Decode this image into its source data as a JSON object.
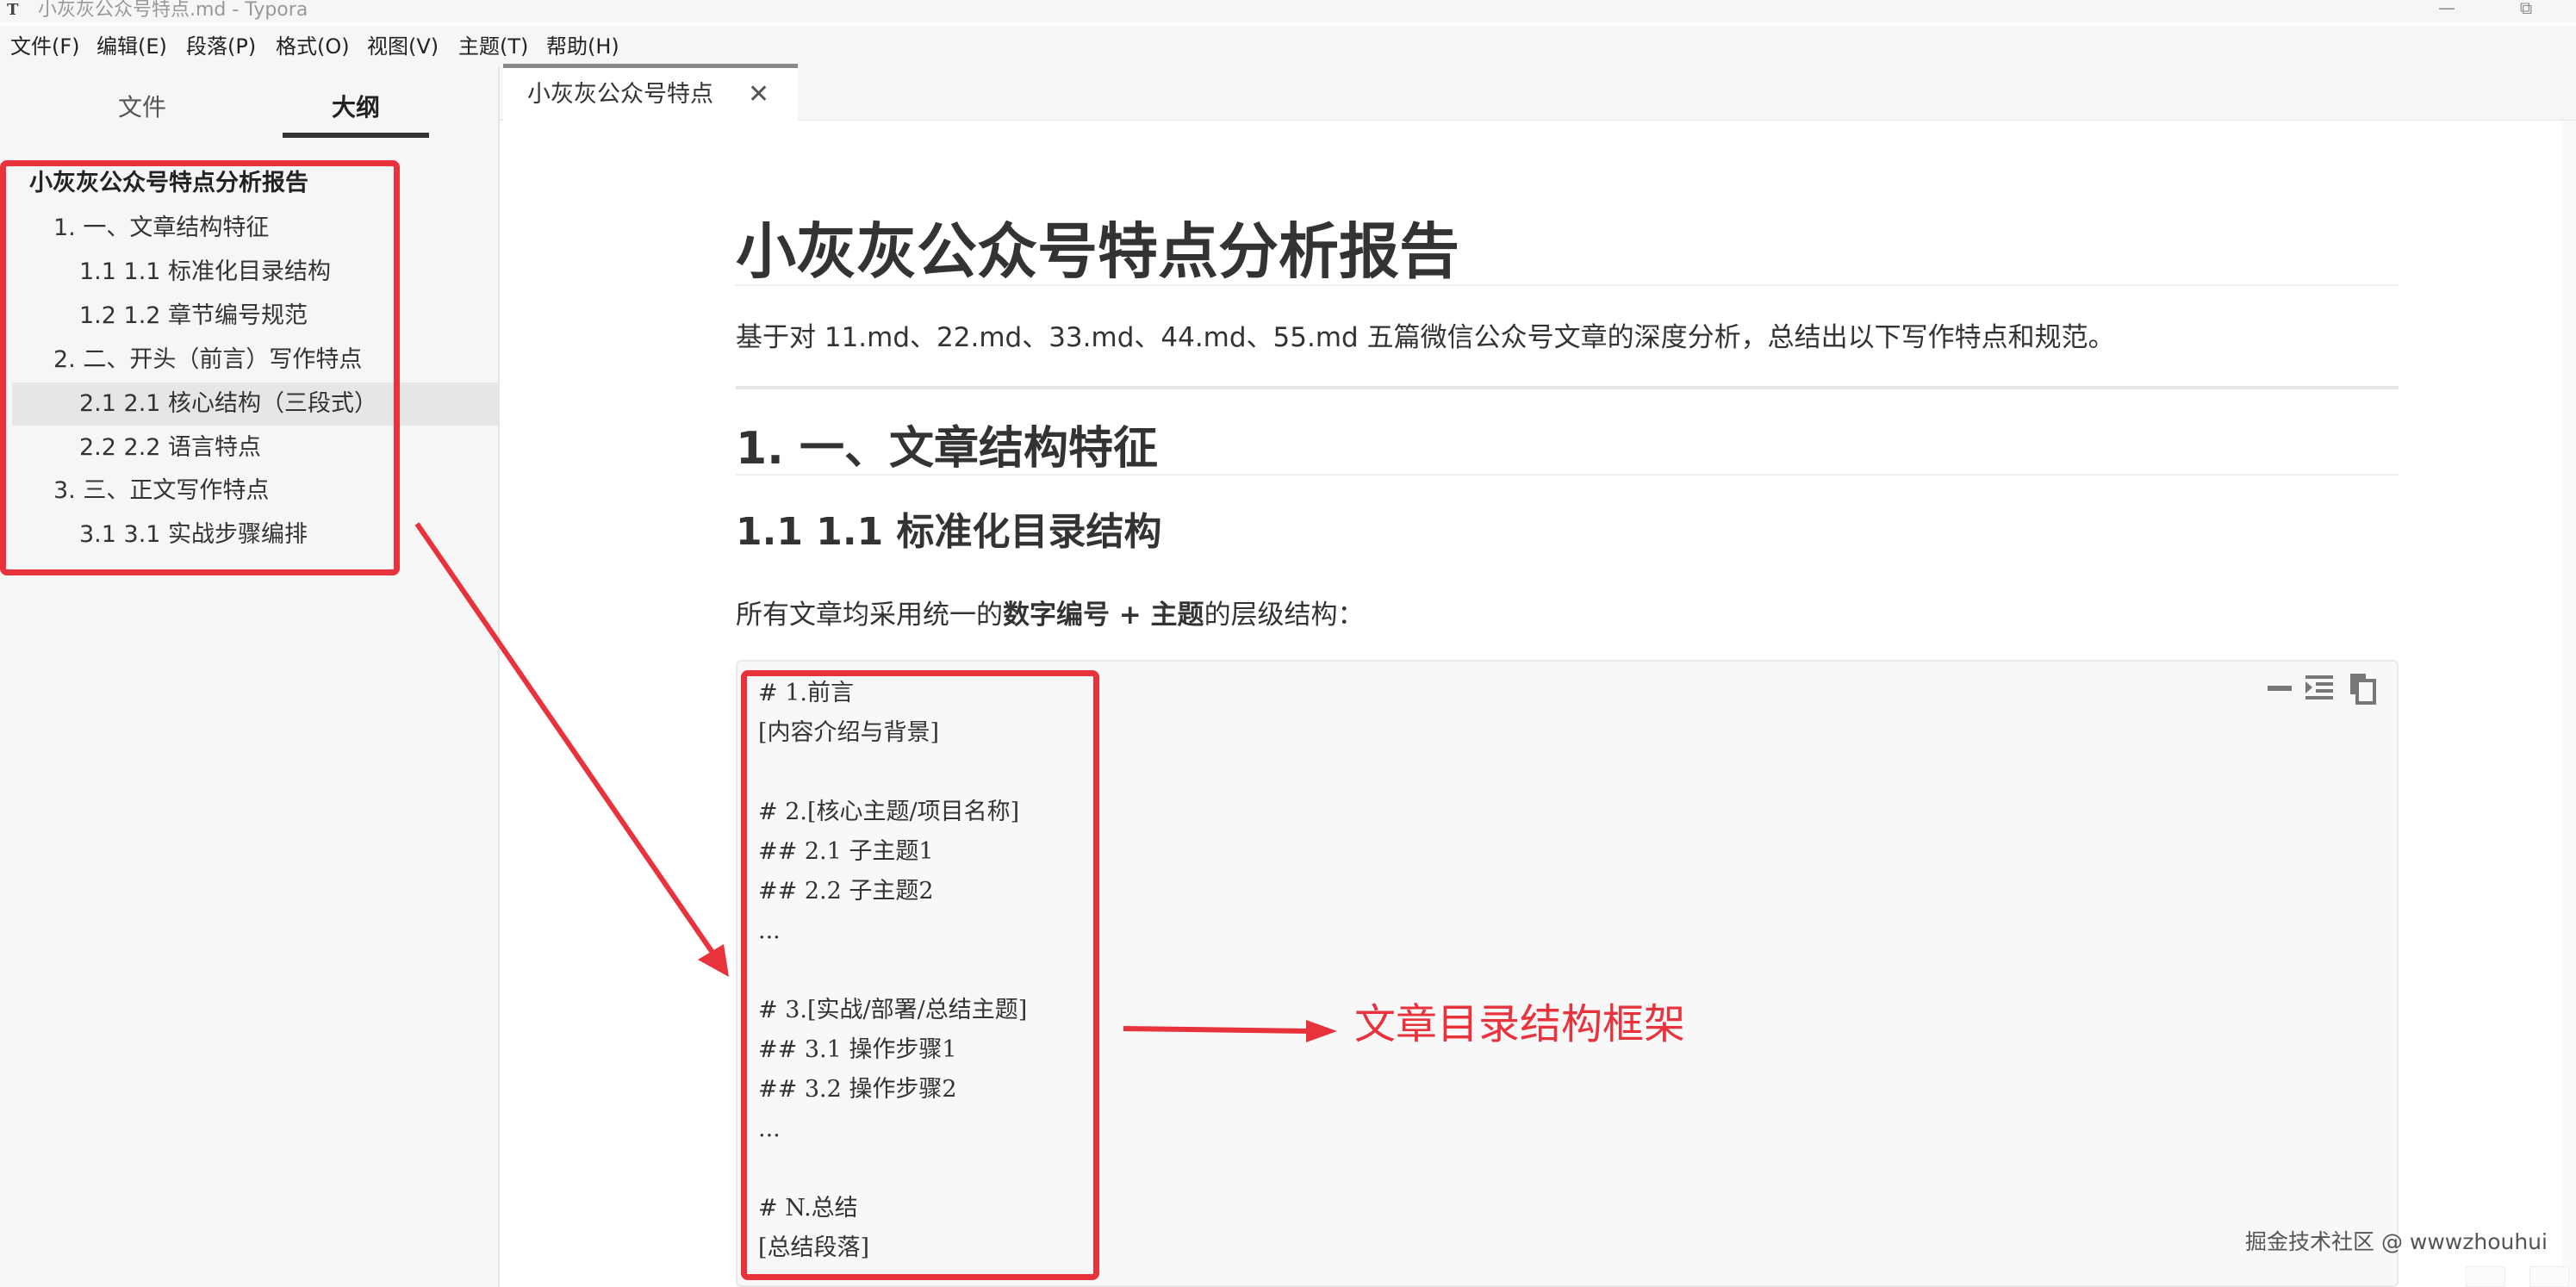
{
  "window": {
    "app_icon_letter": "T",
    "title": "小灰灰公众号特点.md - Typora",
    "minimize_glyph": "—",
    "restore_glyph": "⧉"
  },
  "menu": {
    "items": [
      "文件(F)",
      "编辑(E)",
      "段落(P)",
      "格式(O)",
      "视图(V)",
      "主题(T)",
      "帮助(H)"
    ]
  },
  "sidebar": {
    "tabs": [
      "文件",
      "大纲"
    ],
    "active_tab": "大纲",
    "outline": [
      {
        "label": "小灰灰公众号特点分析报告",
        "level": 1
      },
      {
        "label": "1. 一、文章结构特征",
        "level": 2
      },
      {
        "label": "1.1 1.1 标准化目录结构",
        "level": 3
      },
      {
        "label": "1.2 1.2 章节编号规范",
        "level": 3
      },
      {
        "label": "2. 二、开头（前言）写作特点",
        "level": 2
      },
      {
        "label": "2.1 2.1 核心结构（三段式）",
        "level": 3,
        "active": true
      },
      {
        "label": "2.2 2.2 语言特点",
        "level": 3
      },
      {
        "label": "3. 三、正文写作特点",
        "level": 2
      },
      {
        "label": "3.1 3.1 实战步骤编排",
        "level": 3
      }
    ]
  },
  "editor": {
    "tab_title": "小灰灰公众号特点",
    "tab_close_glyph": "✕",
    "h1": "小灰灰公众号特点分析报告",
    "intro": "基于对 11.md、22.md、33.md、44.md、55.md 五篇微信公众号文章的深度分析，总结出以下写作特点和规范。",
    "h2": "1. 一、文章结构特征",
    "h3": "1.1 1.1 标准化目录结构",
    "para": {
      "before": "所有文章均采用统一的",
      "bold": "数字编号 + 主题",
      "after": "的层级结构："
    },
    "code_lines": [
      "# 1.前言",
      "[内容介绍与背景]",
      "",
      "# 2.[核心主题/项目名称]",
      "## 2.1 子主题1",
      "## 2.2 子主题2",
      "...",
      "",
      "# 3.[实战/部署/总结主题]",
      "## 3.1 操作步骤1",
      "## 3.2 操作步骤2",
      "...",
      "",
      "# N.总结",
      "[总结段落]"
    ],
    "code_toolbar": [
      "collapse-icon",
      "indent-icon",
      "copy-icon"
    ]
  },
  "annotation": {
    "text": "文章目录结构框架",
    "color": "#e8323c"
  },
  "watermark": "掘金技术社区 @ wwwzhouhui"
}
